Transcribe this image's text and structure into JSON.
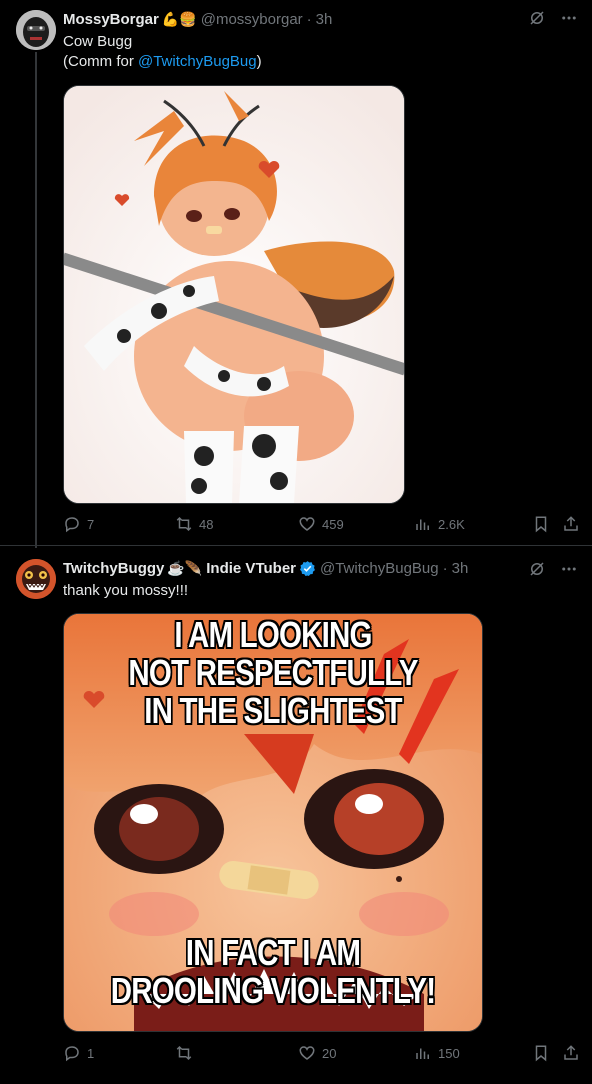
{
  "tweets": [
    {
      "display_name": "MossyBorgar",
      "name_emojis": "💪🍔",
      "handle": "@mossyborgar",
      "time": "3h",
      "text_line1": "Cow Bugg",
      "text_prefix": "(Comm for ",
      "mention": "@TwitchyBugBug",
      "text_suffix": ")",
      "stats": {
        "replies": "7",
        "reposts": "48",
        "likes": "459",
        "views": "2.6K"
      }
    },
    {
      "display_name": "TwitchyBuggy",
      "name_emojis": "☕🪶",
      "name_suffix": "Indie VTuber",
      "handle": "@TwitchyBugBug",
      "time": "3h",
      "text_line1": "thank you mossy!!!",
      "meme_top": [
        "I AM LOOKING",
        "NOT RESPECTFULLY",
        "IN THE SLIGHTEST"
      ],
      "meme_bottom": [
        "IN FACT I AM",
        "DROOLING VIOLENTLY!"
      ],
      "stats": {
        "replies": "1",
        "reposts": "",
        "likes": "20",
        "views": "150"
      }
    }
  ],
  "colors": {
    "accent": "#1d9bf0",
    "muted": "#71767b",
    "background": "#000000"
  }
}
